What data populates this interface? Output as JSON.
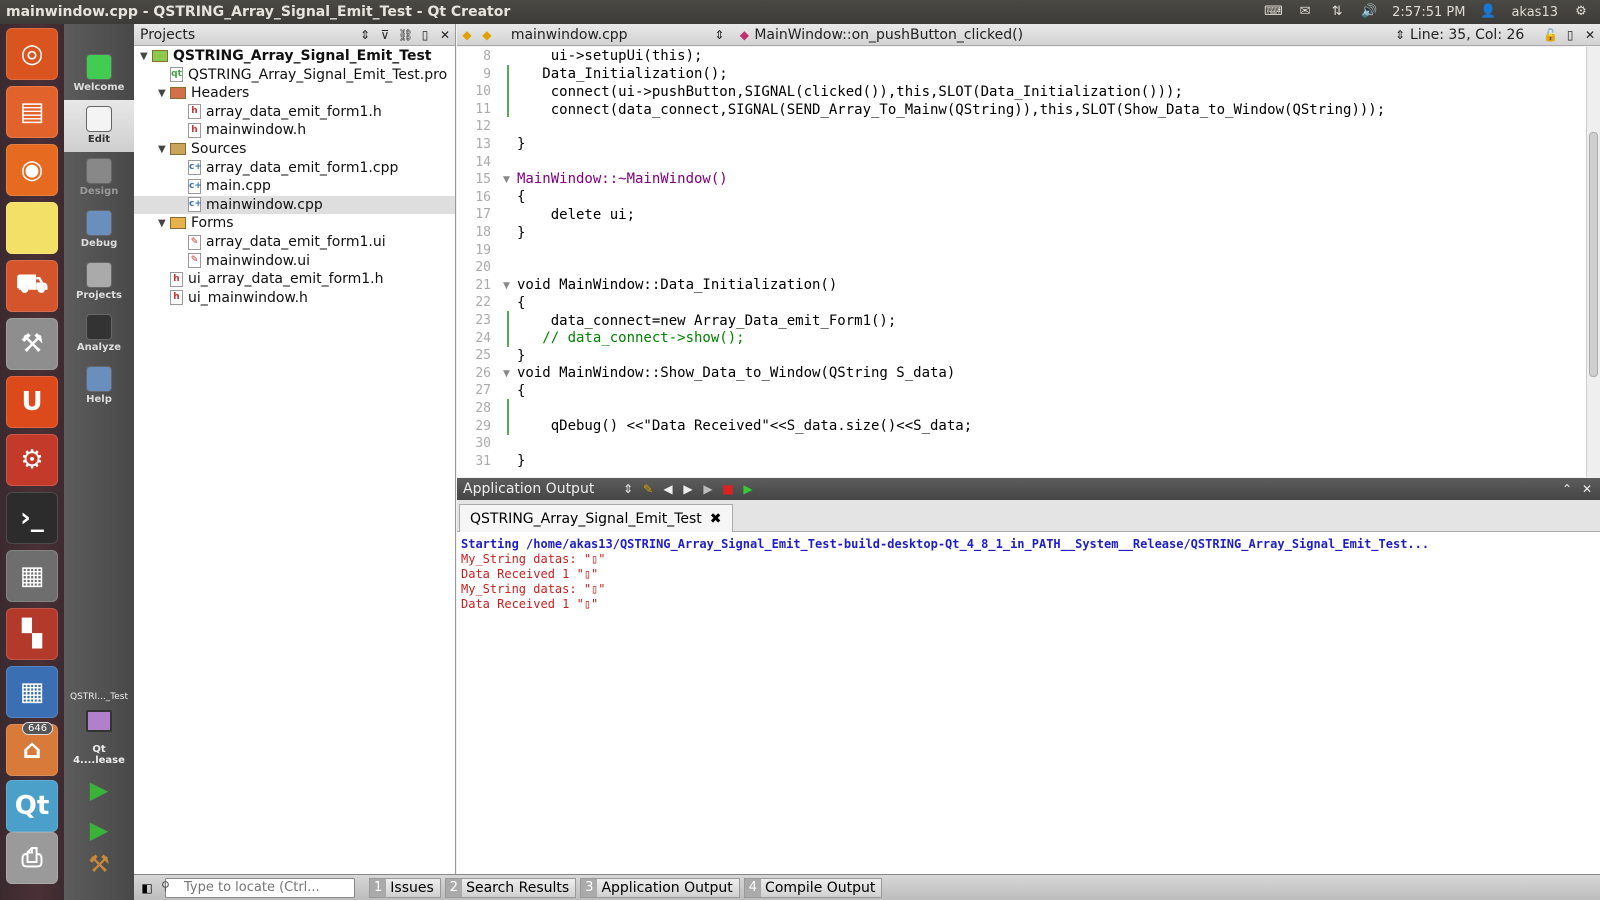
{
  "window": {
    "title": "mainwindow.cpp - QSTRING_Array_Signal_Emit_Test - Qt Creator"
  },
  "top_panel": {
    "time": "2:57:51 PM",
    "user": "akas13",
    "icons": [
      "keyboard-icon",
      "mail-icon",
      "network-icon",
      "volume-icon",
      "user-icon",
      "gear-icon"
    ]
  },
  "launcher": {
    "badge_count": "646",
    "items": [
      {
        "name": "ubuntu-logo-icon",
        "color": "#d9541e"
      },
      {
        "name": "files-icon",
        "color": "#e2622c"
      },
      {
        "name": "firefox-icon",
        "color": "#e66a1f"
      },
      {
        "name": "notes-icon",
        "color": "#f3e066"
      },
      {
        "name": "software-center-icon",
        "color": "#d4542c"
      },
      {
        "name": "system-tools-icon",
        "color": "#8e8e8e"
      },
      {
        "name": "ubuntu-one-icon",
        "color": "#dc4a1c"
      },
      {
        "name": "settings-icon",
        "color": "#c43a2a"
      },
      {
        "name": "terminal-icon",
        "color": "#2c2c2c"
      },
      {
        "name": "calculator-icon",
        "color": "#6e6e6e"
      },
      {
        "name": "workspace-switcher-icon",
        "color": "#b33a2a"
      },
      {
        "name": "spreadsheet-icon",
        "color": "#3a6fb3"
      },
      {
        "name": "home-folder-icon",
        "color": "#d87a3a"
      },
      {
        "name": "qtcreator-icon",
        "color": "#4aa0c8"
      },
      {
        "name": "printer-icon",
        "color": "#9a9a9a"
      }
    ]
  },
  "modes": [
    {
      "label": "Welcome"
    },
    {
      "label": "Edit"
    },
    {
      "label": "Design"
    },
    {
      "label": "Debug"
    },
    {
      "label": "Projects"
    },
    {
      "label": "Analyze"
    },
    {
      "label": "Help"
    }
  ],
  "kit": {
    "project": "QSTRI..._Test",
    "config": "Qt 4....lease"
  },
  "projects_pane": {
    "title": "Projects",
    "tree": [
      {
        "label": "QSTRING_Array_Signal_Emit_Test",
        "depth": 0,
        "kind": "project"
      },
      {
        "label": "QSTRING_Array_Signal_Emit_Test.pro",
        "depth": 1,
        "kind": "pro"
      },
      {
        "label": "Headers",
        "depth": 1,
        "kind": "folder-h"
      },
      {
        "label": "array_data_emit_form1.h",
        "depth": 2,
        "kind": "h"
      },
      {
        "label": "mainwindow.h",
        "depth": 2,
        "kind": "h"
      },
      {
        "label": "Sources",
        "depth": 1,
        "kind": "folder"
      },
      {
        "label": "array_data_emit_form1.cpp",
        "depth": 2,
        "kind": "cpp"
      },
      {
        "label": "main.cpp",
        "depth": 2,
        "kind": "cpp"
      },
      {
        "label": "mainwindow.cpp",
        "depth": 2,
        "kind": "cpp",
        "selected": true
      },
      {
        "label": "Forms",
        "depth": 1,
        "kind": "folder-f"
      },
      {
        "label": "array_data_emit_form1.ui",
        "depth": 2,
        "kind": "ui"
      },
      {
        "label": "mainwindow.ui",
        "depth": 2,
        "kind": "ui"
      },
      {
        "label": "ui_array_data_emit_form1.h",
        "depth": 1,
        "kind": "h"
      },
      {
        "label": "ui_mainwindow.h",
        "depth": 1,
        "kind": "h"
      }
    ]
  },
  "editor": {
    "file": "mainwindow.cpp",
    "function": "MainWindow::on_pushButton_clicked()",
    "position": "Line: 35, Col: 26",
    "lines": [
      {
        "n": "8"
      },
      {
        "n": "9"
      },
      {
        "n": "10"
      },
      {
        "n": "11"
      },
      {
        "n": "12"
      },
      {
        "n": "13"
      },
      {
        "n": "14"
      },
      {
        "n": "15"
      },
      {
        "n": "16"
      },
      {
        "n": "17"
      },
      {
        "n": "18"
      },
      {
        "n": "19"
      },
      {
        "n": "20"
      },
      {
        "n": "21"
      },
      {
        "n": "22"
      },
      {
        "n": "23"
      },
      {
        "n": "24"
      },
      {
        "n": "25"
      },
      {
        "n": "26"
      },
      {
        "n": "27"
      },
      {
        "n": "28"
      },
      {
        "n": "29"
      },
      {
        "n": "30"
      },
      {
        "n": "31"
      }
    ],
    "code": {
      "l8": "    ui->setupUi(this);",
      "l9": "   Data_Initialization();",
      "l10": "    connect(ui->pushButton,SIGNAL(clicked()),this,SLOT(Data_Initialization()));",
      "l11": "    connect(data_connect,SIGNAL(SEND_Array_To_Mainw(QString)),this,SLOT(Show_Data_to_Window(QString)));",
      "l13": "}",
      "l15": "MainWindow::~MainWindow()",
      "l16": "{",
      "l17": "    delete ui;",
      "l18": "}",
      "l21": "void MainWindow::Data_Initialization()",
      "l22": "{",
      "l23": "    data_connect=new Array_Data_emit_Form1();",
      "l24": "   // data_connect->show();",
      "l25": "}",
      "l26": "void MainWindow::Show_Data_to_Window(QString S_data)",
      "l27": "{",
      "l29": "    qDebug() <<\"Data Received\"<<S_data.size()<<S_data;",
      "l31": "}"
    }
  },
  "output": {
    "title": "Application Output",
    "tab": "QSTRING_Array_Signal_Emit_Test",
    "lines": [
      {
        "text": "Starting /home/akas13/QSTRING_Array_Signal_Emit_Test-build-desktop-Qt_4_8_1_in_PATH__System__Release/QSTRING_Array_Signal_Emit_Test...",
        "color": "#1e1ec8"
      },
      {
        "text": "My_String datas: \"▯\"",
        "color": "#c81e1e"
      },
      {
        "text": "Data Received 1 \"▯\"",
        "color": "#c81e1e"
      },
      {
        "text": "My_String datas: \"▯\"",
        "color": "#c81e1e"
      },
      {
        "text": "Data Received 1 \"▯\"",
        "color": "#c81e1e"
      }
    ]
  },
  "bottom": {
    "locate_placeholder": "Type to locate (Ctrl...",
    "panes": [
      {
        "num": "1",
        "label": "Issues"
      },
      {
        "num": "2",
        "label": "Search Results"
      },
      {
        "num": "3",
        "label": "Application Output"
      },
      {
        "num": "4",
        "label": "Compile Output"
      }
    ]
  }
}
